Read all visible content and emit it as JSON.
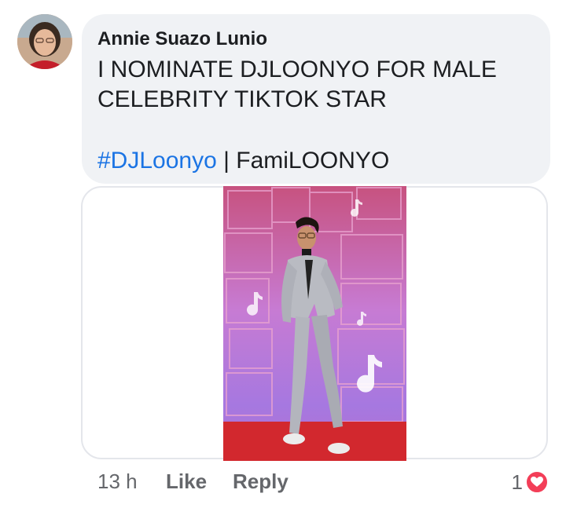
{
  "comment": {
    "author": "Annie Suazo Lunio",
    "text": "I NOMINATE DJLOONYO FOR MALE CELEBRITY TIKTOK STAR",
    "hashtag": "#DJLoonyo",
    "separator": " | ",
    "tag_suffix": "FamiLOONYO"
  },
  "footer": {
    "time": "13 h",
    "like_label": "Like",
    "reply_label": "Reply",
    "reaction_count": "1",
    "reaction_icon": "heart-icon"
  },
  "colors": {
    "bubble_bg": "#f0f2f5",
    "hashtag": "#1b74e4",
    "meta_text": "#65676b",
    "heart": "#f33e58"
  }
}
